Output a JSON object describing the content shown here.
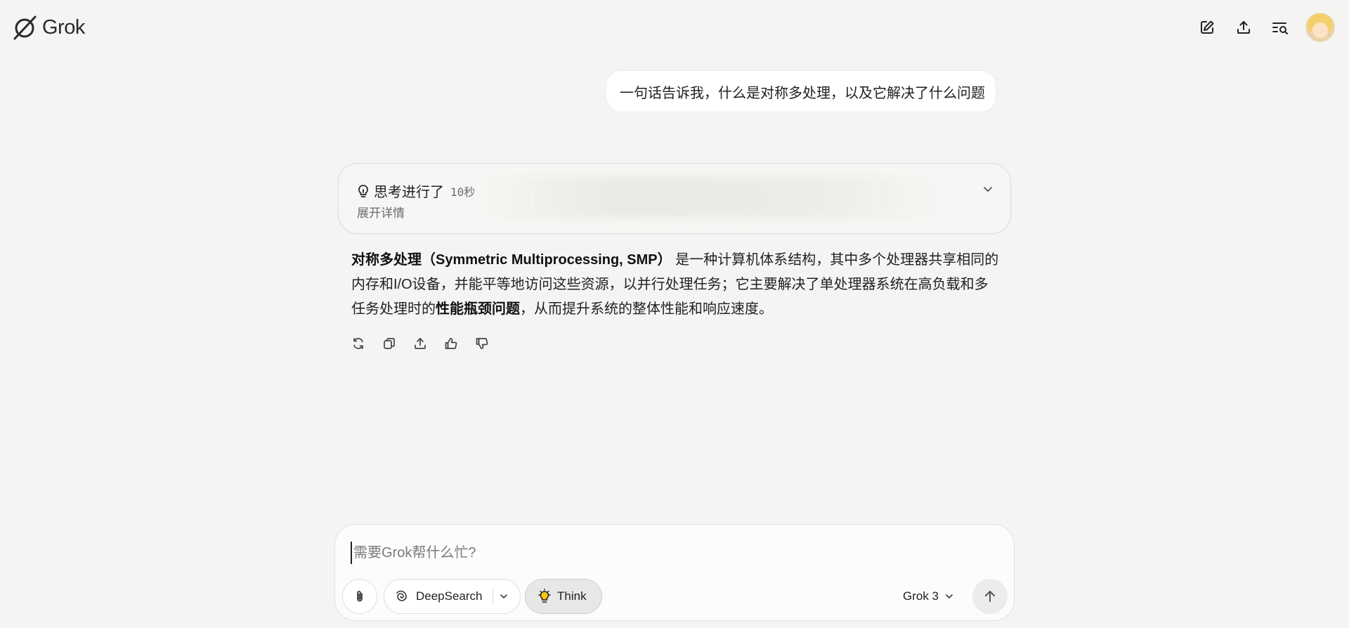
{
  "header": {
    "brand": "Grok",
    "icons": [
      "new-chat-icon",
      "share-icon",
      "history-search-icon"
    ]
  },
  "conversation": {
    "user_message": "一句话告诉我，什么是对称多处理，以及它解决了什么问题",
    "thinking": {
      "title": "思考进行了",
      "duration": "10秒",
      "expand_label": "展开详情"
    },
    "answer": {
      "bold_term": "对称多处理（Symmetric Multiprocessing, SMP）",
      "part1": " 是一种计算机体系结构，其中多个处理器共享相同的内存和I/O设备，并能平等地访问这些资源，以并行处理任务；它主要解决了单处理器系统在高负载和多任务处理时的",
      "bold_problem": "性能瓶颈问题",
      "part2": "，从而提升系统的整体性能和响应速度。"
    },
    "message_actions": [
      "regenerate-icon",
      "copy-icon",
      "share-icon",
      "thumbs-up-icon",
      "thumbs-down-icon"
    ]
  },
  "composer": {
    "placeholder": "需要Grok帮什么忙?",
    "deepsearch_label": "DeepSearch",
    "think_label": "Think",
    "model_label": "Grok 3"
  },
  "colors": {
    "background": "#f5f4f2",
    "bubble": "#ffffff",
    "think_active": "#e7e7e6",
    "think_bulb": "#e8a800"
  }
}
